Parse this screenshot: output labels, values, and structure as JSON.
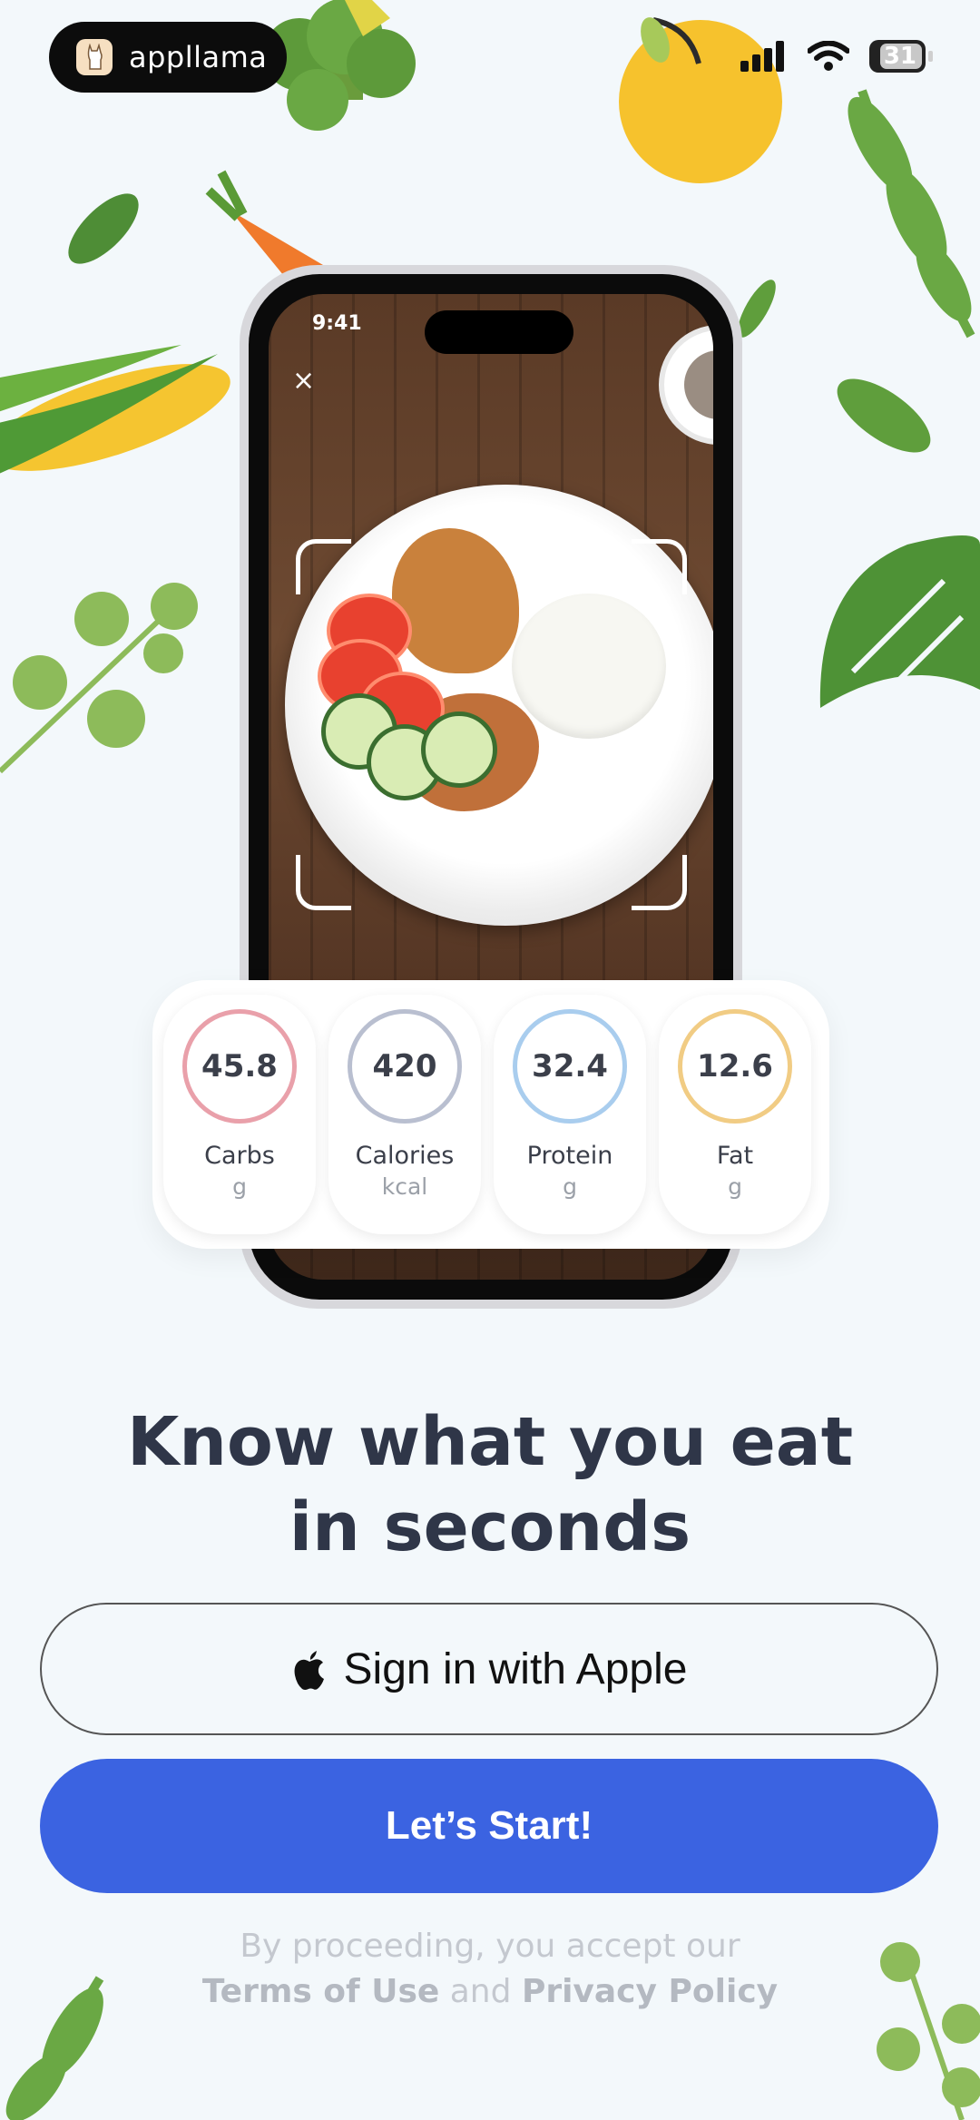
{
  "status_bar": {
    "brand_name": "appllama",
    "battery": "31",
    "icons": [
      "signal-icon",
      "wifi-icon",
      "battery-icon"
    ]
  },
  "phone_mockup": {
    "time": "9:41",
    "close_glyph": "×"
  },
  "nutrition": [
    {
      "value": "45.8",
      "label": "Carbs",
      "unit": "g",
      "color": "#e9a0aa"
    },
    {
      "value": "420",
      "label": "Calories",
      "unit": "kcal",
      "color": "#b9bfd0"
    },
    {
      "value": "32.4",
      "label": "Protein",
      "unit": "g",
      "color": "#a9cdee"
    },
    {
      "value": "12.6",
      "label": "Fat",
      "unit": "g",
      "color": "#f1cc84"
    }
  ],
  "headline": {
    "line1": "Know what you eat",
    "line2": "in seconds"
  },
  "buttons": {
    "apple_label": "Sign in with Apple",
    "start_label": "Let’s Start!"
  },
  "legal": {
    "prefix": "By proceeding, you accept our",
    "terms": "Terms of Use",
    "and": "and",
    "privacy": "Privacy Policy"
  },
  "colors": {
    "background": "#f3f8fb",
    "primary": "#3b63e1",
    "text": "#2f3648"
  }
}
